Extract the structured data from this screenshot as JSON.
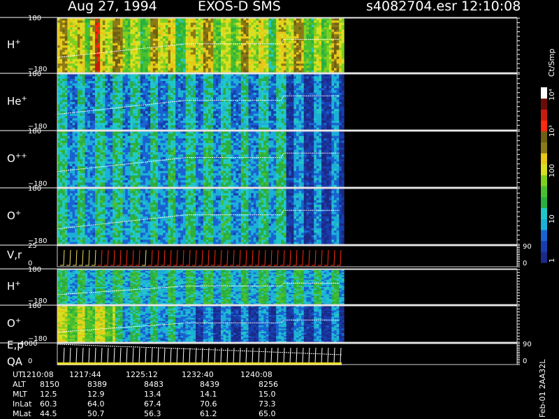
{
  "header": {
    "date": "Aug 27, 1994",
    "instrument": "EXOS-D SMS",
    "file": "s4082704.esr",
    "time": "12:10:08"
  },
  "colorbar": {
    "unit": "Ct/Smp",
    "ticks": [
      "1",
      "10",
      "100",
      "10³",
      "10⁴"
    ]
  },
  "footer": {
    "rows": [
      {
        "label": "UT",
        "values": [
          "1210:08",
          "1217:44",
          "1225:12",
          "1232:40",
          "1240:08"
        ]
      },
      {
        "label": "ALT",
        "values": [
          "8150",
          "8389",
          "8483",
          "8439",
          "8256"
        ]
      },
      {
        "label": "MLT",
        "values": [
          "12.5",
          "12.9",
          "13.4",
          "14.1",
          "15.0"
        ]
      },
      {
        "label": "InLat",
        "values": [
          "60.3",
          "64.0",
          "67.4",
          "70.6",
          "73.3"
        ]
      },
      {
        "label": "MLat",
        "values": [
          "44.5",
          "50.7",
          "56.3",
          "61.2",
          "65.0"
        ]
      }
    ],
    "side_note": "Feb-01 2AA32L"
  },
  "chart_data": {
    "type": "heatmap",
    "title": "Aug 27, 1994   EXOS-D SMS",
    "colorscale": [
      "#1c2a88",
      "#183fae",
      "#1a63d2",
      "#1cb0d8",
      "#22c8c8",
      "#2ab040",
      "#48c030",
      "#80d020",
      "#d8e020",
      "#e8c818",
      "#8a7a18",
      "#706014",
      "#ff2a10",
      "#c81c10",
      "#6a0c08",
      "#ffffff"
    ],
    "panels": [
      {
        "label": "H",
        "charge": "+",
        "ylim": [
          -180,
          180
        ],
        "tick_labels": [
          "180",
          "−180"
        ]
      },
      {
        "label": "He",
        "charge": "+",
        "ylim": [
          -180,
          180
        ],
        "tick_labels": [
          "180",
          "−180"
        ]
      },
      {
        "label": "O",
        "charge": "++",
        "ylim": [
          -180,
          180
        ],
        "tick_labels": [
          "180",
          "−180"
        ]
      },
      {
        "label": "O",
        "charge": "+",
        "ylim": [
          -180,
          180
        ],
        "tick_labels": [
          "180",
          "−180"
        ]
      },
      {
        "label": "V,r",
        "charge": "",
        "ylim": [
          0,
          25
        ],
        "tick_labels": [
          "25",
          "0"
        ],
        "right_ticks": [
          "90",
          "0"
        ]
      },
      {
        "label": "H",
        "charge": "+",
        "ylim": [
          -180,
          180
        ],
        "tick_labels": [
          "180",
          "−180"
        ]
      },
      {
        "label": "O",
        "charge": "+",
        "ylim": [
          -180,
          180
        ],
        "tick_labels": [
          "180",
          "−180"
        ]
      },
      {
        "label": "E,p",
        "label2": "QA",
        "charge": "",
        "ylim": [
          0,
          4000
        ],
        "tick_labels": [
          "4000",
          "0"
        ],
        "right_ticks": [
          "90",
          "0"
        ]
      }
    ]
  }
}
